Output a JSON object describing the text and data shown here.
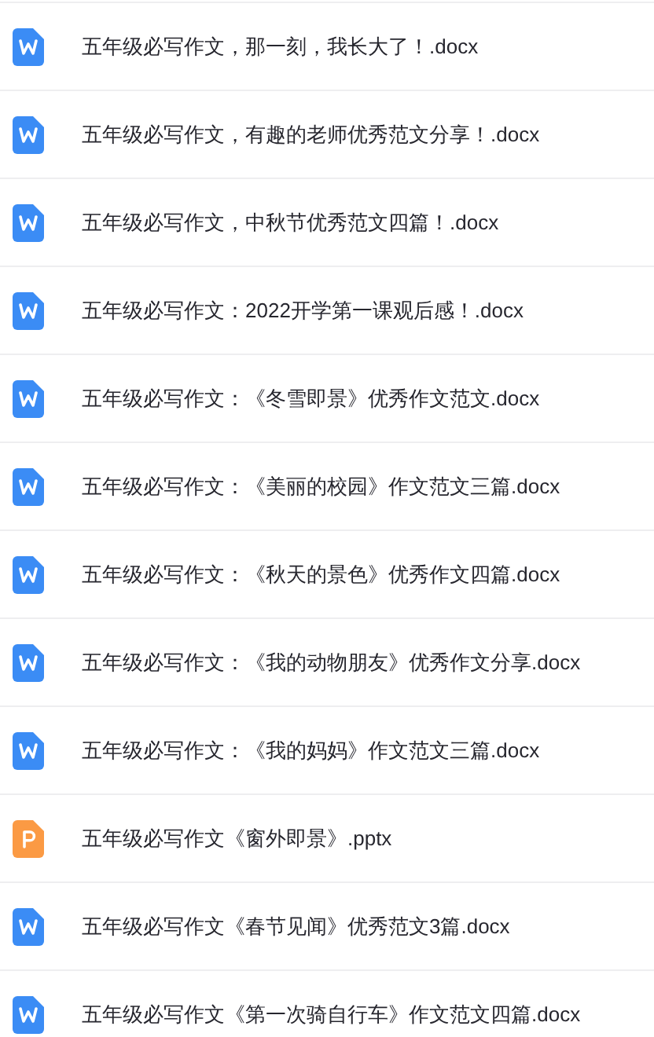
{
  "files": [
    {
      "name": "五年级必写作文，那一刻，我长大了！.docx",
      "kind": "word"
    },
    {
      "name": "五年级必写作文，有趣的老师优秀范文分享！.docx",
      "kind": "word"
    },
    {
      "name": "五年级必写作文，中秋节优秀范文四篇！.docx",
      "kind": "word"
    },
    {
      "name": "五年级必写作文：2022开学第一课观后感！.docx",
      "kind": "word"
    },
    {
      "name": "五年级必写作文：《冬雪即景》优秀作文范文.docx",
      "kind": "word"
    },
    {
      "name": "五年级必写作文：《美丽的校园》作文范文三篇.docx",
      "kind": "word"
    },
    {
      "name": "五年级必写作文：《秋天的景色》优秀作文四篇.docx",
      "kind": "word"
    },
    {
      "name": "五年级必写作文：《我的动物朋友》优秀作文分享.docx",
      "kind": "word"
    },
    {
      "name": "五年级必写作文：《我的妈妈》作文范文三篇.docx",
      "kind": "word"
    },
    {
      "name": "五年级必写作文《窗外即景》.pptx",
      "kind": "slides"
    },
    {
      "name": "五年级必写作文《春节见闻》优秀范文3篇.docx",
      "kind": "word"
    },
    {
      "name": "五年级必写作文《第一次骑自行车》作文范文四篇.docx",
      "kind": "word"
    }
  ]
}
